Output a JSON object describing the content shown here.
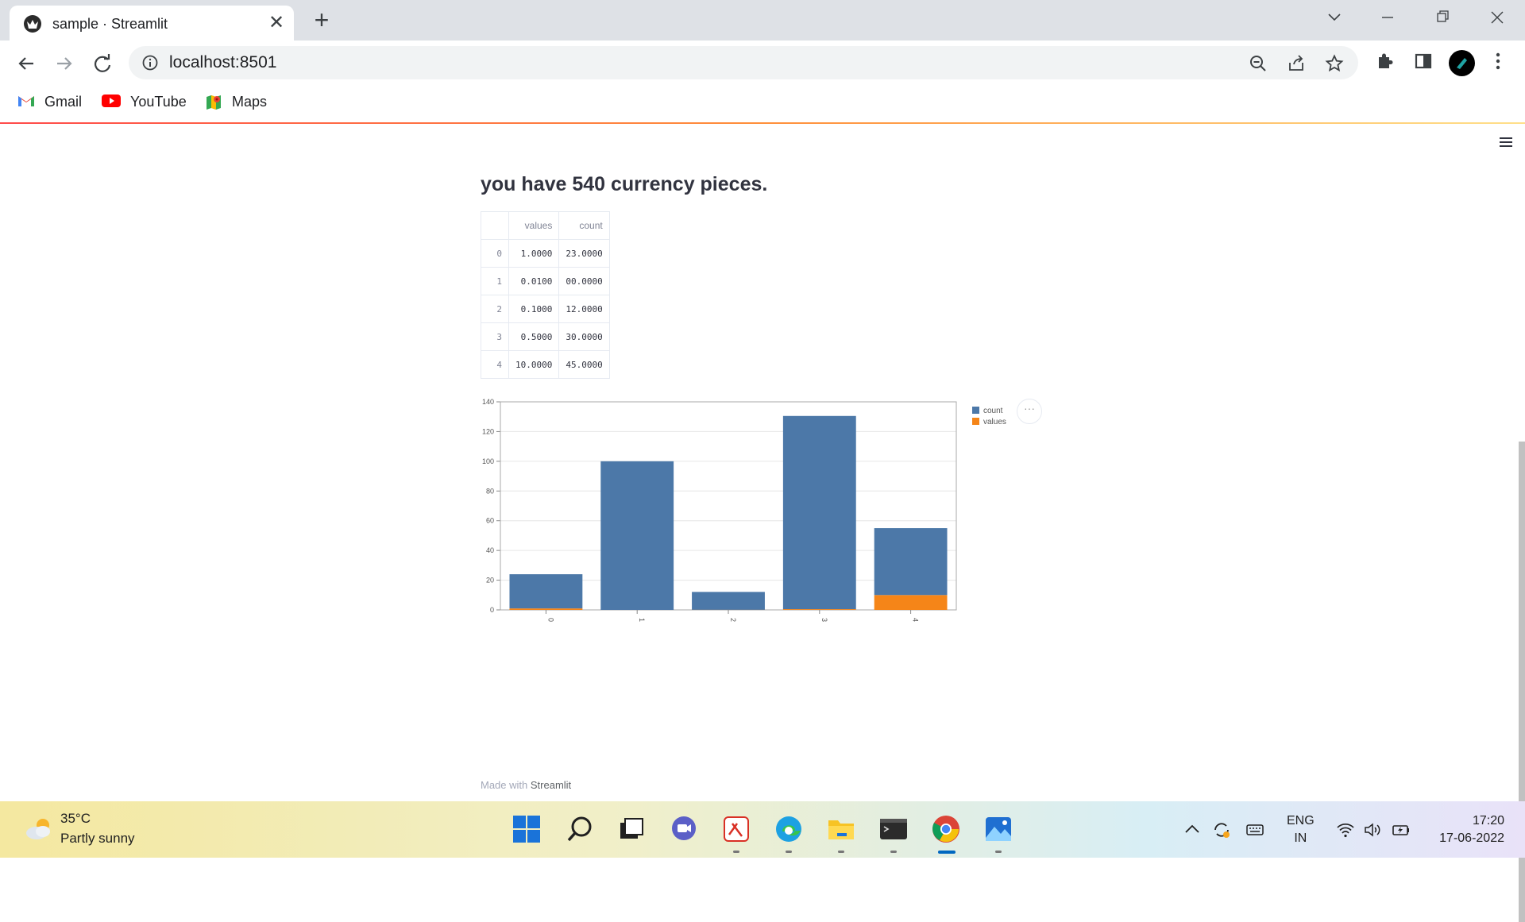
{
  "browser": {
    "tab_title": "sample · Streamlit",
    "url": "localhost:8501",
    "bookmarks": [
      {
        "label": "Gmail",
        "icon": "gmail-icon"
      },
      {
        "label": "YouTube",
        "icon": "youtube-icon"
      },
      {
        "label": "Maps",
        "icon": "maps-icon"
      }
    ]
  },
  "page": {
    "heading": "you have 540 currency pieces.",
    "table": {
      "columns": [
        "values",
        "count"
      ],
      "rows": [
        {
          "index": "0",
          "values": "1.0000",
          "count": "23.0000"
        },
        {
          "index": "1",
          "values": "0.0100",
          "count": "00.0000"
        },
        {
          "index": "2",
          "values": "0.1000",
          "count": "12.0000"
        },
        {
          "index": "3",
          "values": "0.5000",
          "count": "30.0000"
        },
        {
          "index": "4",
          "values": "10.0000",
          "count": "45.0000"
        }
      ]
    },
    "footer_prefix": "Made with",
    "footer_brand": "Streamlit",
    "chart_menu": "···"
  },
  "chart_data": {
    "type": "bar",
    "stacked": true,
    "categories": [
      "0",
      "1",
      "2",
      "3",
      "4"
    ],
    "series": [
      {
        "name": "count",
        "color": "#4c78a8",
        "values": [
          23,
          100,
          12,
          130,
          45
        ]
      },
      {
        "name": "values",
        "color": "#f58518",
        "values": [
          1,
          0.01,
          0.1,
          0.5,
          10
        ]
      }
    ],
    "yticks": [
      0,
      20,
      40,
      60,
      80,
      100,
      120,
      140
    ],
    "ylim": [
      0,
      140
    ],
    "grid": true,
    "legend_position": "right"
  },
  "taskbar": {
    "temperature": "35°C",
    "weather": "Partly sunny",
    "language_top": "ENG",
    "language_bottom": "IN",
    "time": "17:20",
    "date": "17-06-2022"
  }
}
